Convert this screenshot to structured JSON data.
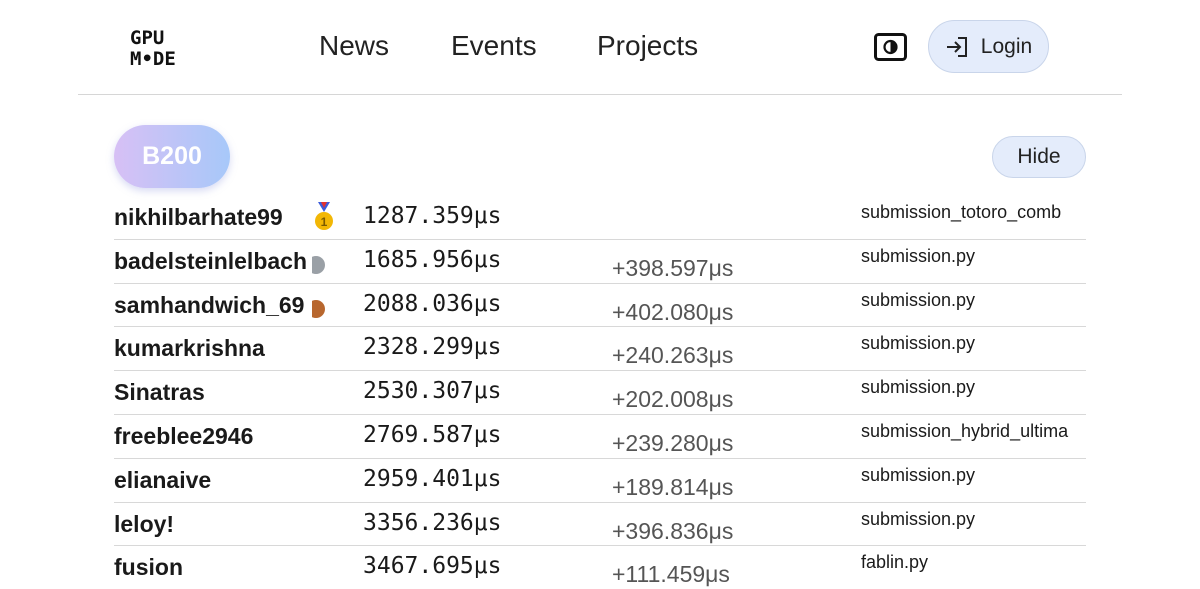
{
  "header": {
    "logo": {
      "line1": "GPU",
      "line2": "M•DE"
    },
    "nav": [
      {
        "label": "News"
      },
      {
        "label": "Events"
      },
      {
        "label": "Projects"
      }
    ],
    "theme_toggle_icon": "contrast-icon",
    "login": {
      "icon": "login-arrow-icon",
      "label": "Login"
    }
  },
  "section": {
    "gpu_label": "B200",
    "hide_label": "Hide"
  },
  "leaderboard": {
    "rows": [
      {
        "user": "nikhilbarhate99",
        "medal": "gold",
        "time": "1287.359μs",
        "delta": "",
        "file": "submission_totoro_comb"
      },
      {
        "user": "badelsteinlelbach",
        "medal": "silver",
        "time": "1685.956μs",
        "delta": "+398.597μs",
        "file": "submission.py"
      },
      {
        "user": "samhandwich_69",
        "medal": "bronze",
        "time": "2088.036μs",
        "delta": "+402.080μs",
        "file": "submission.py"
      },
      {
        "user": "kumarkrishna",
        "medal": "",
        "time": "2328.299μs",
        "delta": "+240.263μs",
        "file": "submission.py"
      },
      {
        "user": "Sinatras",
        "medal": "",
        "time": "2530.307μs",
        "delta": "+202.008μs",
        "file": "submission.py"
      },
      {
        "user": "freeblee2946",
        "medal": "",
        "time": "2769.587μs",
        "delta": "+239.280μs",
        "file": "submission_hybrid_ultima"
      },
      {
        "user": "elianaive",
        "medal": "",
        "time": "2959.401μs",
        "delta": "+189.814μs",
        "file": "submission.py"
      },
      {
        "user": "leloy!",
        "medal": "",
        "time": "3356.236μs",
        "delta": "+396.836μs",
        "file": "submission.py"
      },
      {
        "user": "fusion",
        "medal": "",
        "time": "3467.695μs",
        "delta": "+111.459μs",
        "file": "fablin.py"
      }
    ]
  },
  "colors": {
    "medal_gold": "#f2b705",
    "medal_silver": "#9aa0a6",
    "medal_bronze": "#b8672e",
    "badge_gradient_start": "#d7c0f5",
    "badge_gradient_end": "#a7c8f9",
    "button_bg": "#e4ecfb"
  }
}
